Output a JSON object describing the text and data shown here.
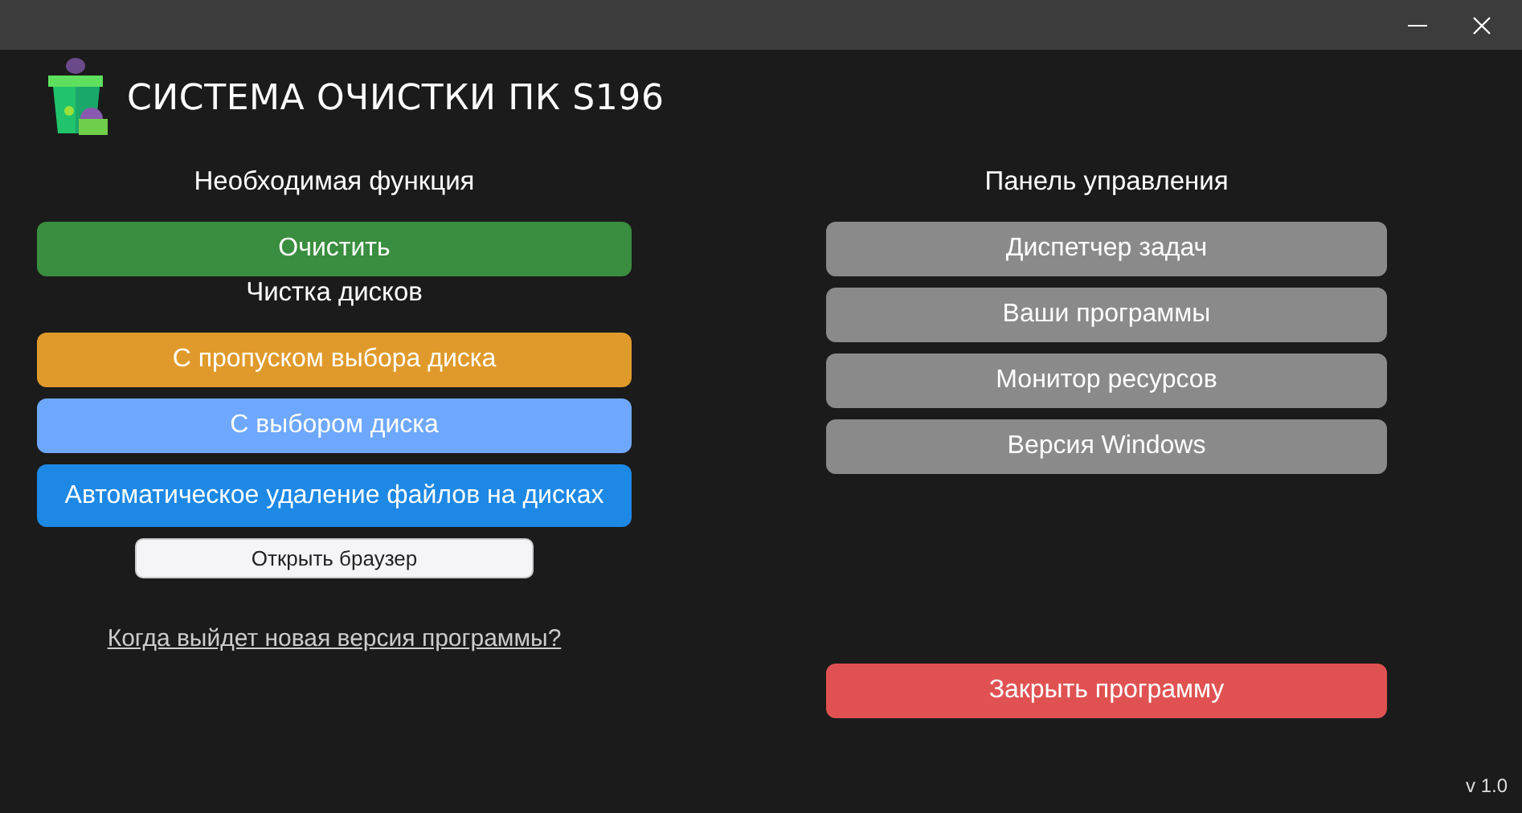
{
  "window": {
    "controls": [
      {
        "kind": "minimize"
      },
      {
        "kind": "close"
      }
    ]
  },
  "app_title": "СИСТЕМА ОЧИСТКИ ПК S196",
  "left": {
    "sections": [
      {
        "heading": "Необходимая функция",
        "buttons": [
          {
            "label": "Очистить",
            "color": "#3a8e3f"
          }
        ]
      },
      {
        "heading": "Чистка дисков",
        "buttons": [
          {
            "label": "С пропуском выбора диска",
            "color": "#e09a2b"
          },
          {
            "label": "С выбором диска",
            "color": "#6ea8fe"
          },
          {
            "label": "Автоматическое удаление файлов на дисках",
            "color": "#1e88e5"
          }
        ]
      }
    ],
    "browser_button": "Открыть браузер",
    "link": "Когда выйдет новая версия программы?"
  },
  "right": {
    "heading": "Панель управления",
    "buttons": [
      {
        "label": "Диспетчер задач",
        "color": "#8a8a8a"
      },
      {
        "label": "Ваши программы",
        "color": "#8a8a8a"
      },
      {
        "label": "Монитор ресурсов",
        "color": "#8a8a8a"
      },
      {
        "label": "Версия Windows",
        "color": "#8a8a8a"
      }
    ],
    "close_button": {
      "label": "Закрыть программу",
      "color": "#e05252"
    }
  },
  "version": "v 1.0"
}
